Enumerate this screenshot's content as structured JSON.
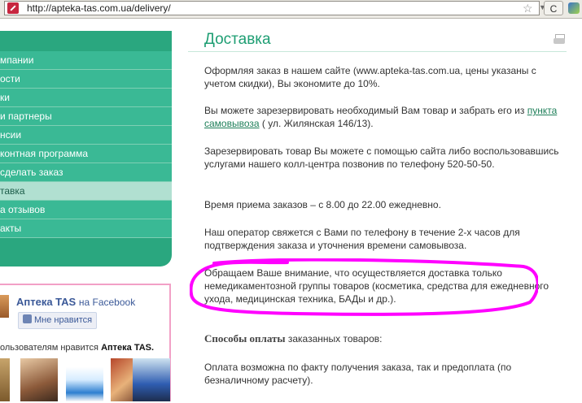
{
  "browser": {
    "url": "http://apteka-tas.com.ua/delivery/",
    "reload_label": "C"
  },
  "sidebar": {
    "items": [
      {
        "label": "мпании",
        "active": false
      },
      {
        "label": "ости",
        "active": false
      },
      {
        "label": "ки",
        "active": false
      },
      {
        "label": "и партнеры",
        "active": false
      },
      {
        "label": "нсии",
        "active": false
      },
      {
        "label": "контная программа",
        "active": false
      },
      {
        "label": "сделать заказ",
        "active": false
      },
      {
        "label": "тавка",
        "active": true
      },
      {
        "label": "а отзывов",
        "active": false
      },
      {
        "label": "акты",
        "active": false
      }
    ]
  },
  "facebook": {
    "page_name": "Аптека TAS",
    "on_label": "на Facebook",
    "like_label": "Мне нравится",
    "count_prefix": "ользователям нравится",
    "count_page": "Аптека TAS."
  },
  "main": {
    "title": "Доставка",
    "p1": "Оформляя заказ в нашем сайте (www.apteka-tas.com.ua, цены указаны с учетом скидки), Вы экономите до 10%.",
    "p2_before": "Вы можете  зарезервировать необходимый Вам товар  и забрать его из ",
    "p2_link": "пункта самовывоза",
    "p2_after": " ( ул. Жилянская 146/13).",
    "p3": "Зарезервировать  товар Вы можете  с помощью сайта  либо воспользовавшись услугами нашего колл-центра  позвонив по телефону 520-50-50.",
    "p4": "Время приема заказов – с 8.00 до 22.00 ежедневно.",
    "p5": "Наш оператор свяжется с Вами по телефону в течение 2-х часов для подтверждения заказа и уточнения времени самовывоза.",
    "p6": "Обращаем Ваше внимание, что осуществляется доставка только немедикаментозной группы товаров  (косметика, средства для ежедневного ухода, медицинская техника, БАДы и др.).",
    "payment_bold": "Способы оплаты",
    "payment_rest": " заказанных товаров:",
    "p8": "Оплата возможна по факту получения заказа, так и предоплата (по безналичному расчету)."
  },
  "colors": {
    "menu_green": "#2aa77f",
    "menu_item": "#3ab995",
    "menu_active": "#b1e0d1",
    "title_green": "#1e9e73",
    "annotation_magenta": "#ff00ff",
    "facebook_blue": "#3b5998"
  },
  "icons": [
    "site-favicon",
    "bookmark-star-icon",
    "dropdown-arrow-icon",
    "reload-icon",
    "extension-icon",
    "print-icon",
    "like-thumb-icon"
  ]
}
